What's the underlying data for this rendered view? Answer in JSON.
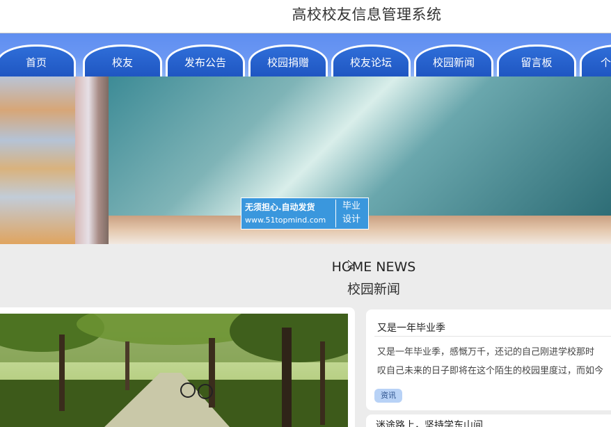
{
  "header": {
    "title": "高校校友信息管理系统"
  },
  "nav": {
    "items": [
      {
        "label": "首页"
      },
      {
        "label": "校友"
      },
      {
        "label": "发布公告"
      },
      {
        "label": "校园捐赠"
      },
      {
        "label": "校友论坛"
      },
      {
        "label": "校园新闻"
      },
      {
        "label": "留言板"
      },
      {
        "label": "个"
      }
    ]
  },
  "watermark": {
    "line1": "无须担心.自动发货",
    "url": "www.51topmind.com",
    "badge1": "毕业",
    "badge2": "设计"
  },
  "news_section": {
    "title_en": "HOME NEWS",
    "title_cn": "校园新闻"
  },
  "news_items": [
    {
      "title": "又是一年毕业季",
      "excerpt_line1": "又是一年毕业季，感慨万千，还记的自己刚进学校那时",
      "excerpt_line2": "叹自己未来的日子即将在这个陌生的校园里度过，而如今",
      "tag": "资讯"
    },
    {
      "title": "迷途路上，坚持学东山间"
    }
  ],
  "colors": {
    "nav_bar": "#6a97f3",
    "tab": "#2f6ed8",
    "watermark": "#3a97dd",
    "tag": "#b8d2f6"
  }
}
